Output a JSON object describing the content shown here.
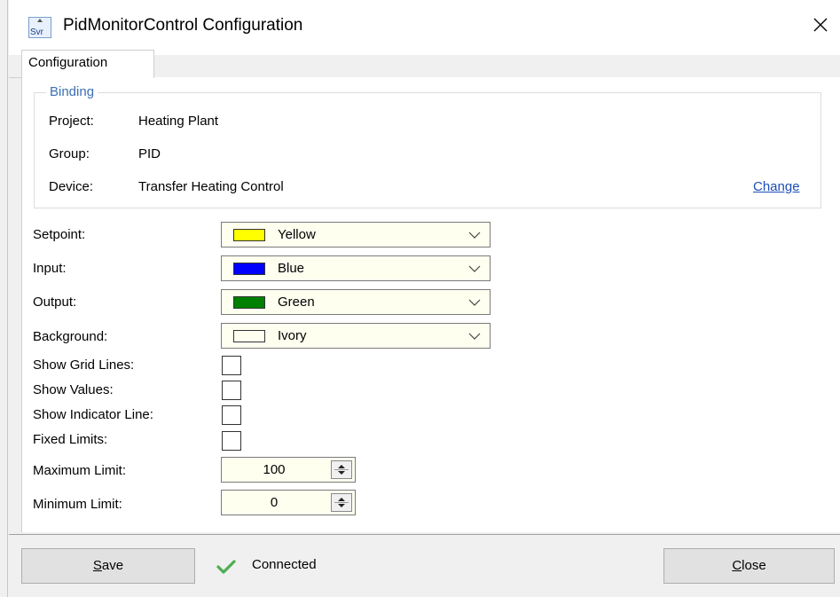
{
  "window": {
    "title": "PidMonitorControl Configuration",
    "icon_text": "Svr"
  },
  "tabs": [
    {
      "label": "Configuration",
      "selected": true
    }
  ],
  "binding": {
    "legend": "Binding",
    "project_label": "Project:",
    "project_value": "Heating Plant",
    "group_label": "Group:",
    "group_value": "PID",
    "device_label": "Device:",
    "device_value": "Transfer Heating Control",
    "change_link": "Change"
  },
  "colors": {
    "setpoint": {
      "label": "Setpoint:",
      "value": "Yellow",
      "swatch": "#ffff00"
    },
    "input": {
      "label": "Input:",
      "value": "Blue",
      "swatch": "#0000ff"
    },
    "output": {
      "label": "Output:",
      "value": "Green",
      "swatch": "#008000"
    },
    "background": {
      "label": "Background:",
      "value": "Ivory",
      "swatch": "#fffff0"
    }
  },
  "options": {
    "show_grid_lines": {
      "label": "Show Grid Lines:",
      "checked": false
    },
    "show_values": {
      "label": "Show Values:",
      "checked": false
    },
    "show_indicator_line": {
      "label": "Show Indicator Line:",
      "checked": false
    },
    "fixed_limits": {
      "label": "Fixed Limits:",
      "checked": false
    }
  },
  "limits": {
    "maximum_label": "Maximum Limit:",
    "maximum_value": "100",
    "minimum_label": "Minimum Limit:",
    "minimum_value": "0"
  },
  "footer": {
    "save_mnemonic": "S",
    "save_rest": "ave",
    "status": "Connected",
    "status_color": "#4caf50",
    "close_mnemonic": "C",
    "close_rest": "lose"
  }
}
